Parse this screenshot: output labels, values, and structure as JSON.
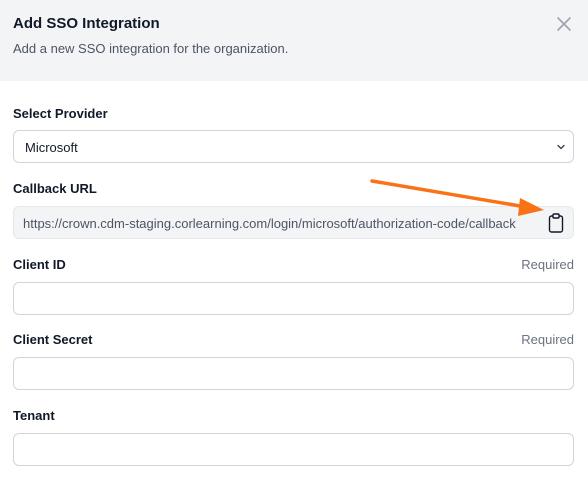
{
  "dialog": {
    "title": "Add SSO Integration",
    "subtitle": "Add a new SSO integration for the organization.",
    "close_icon": "close-icon"
  },
  "provider": {
    "label": "Select Provider",
    "selected": "Microsoft",
    "icon": "chevron-down-icon"
  },
  "callback": {
    "label": "Callback URL",
    "value": "https://crown.cdm-staging.corlearning.com/login/microsoft/authorization-code/callback",
    "icon": "clipboard-icon"
  },
  "client_id": {
    "label": "Client ID",
    "required": "Required",
    "value": ""
  },
  "client_secret": {
    "label": "Client Secret",
    "required": "Required",
    "value": ""
  },
  "tenant": {
    "label": "Tenant",
    "value": ""
  },
  "annotation": {
    "icon": "arrow-icon",
    "color": "#f97316"
  }
}
